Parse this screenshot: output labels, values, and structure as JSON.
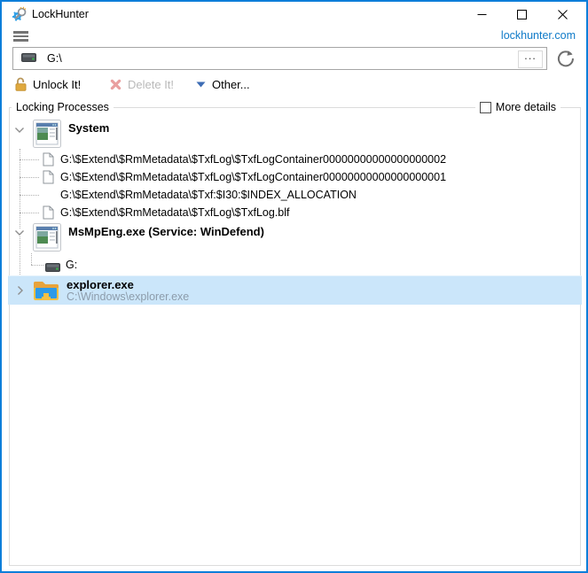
{
  "window": {
    "title": "LockHunter"
  },
  "header": {
    "link": "lockhunter.com"
  },
  "path_bar": {
    "value": "G:\\",
    "browse_label": "..."
  },
  "toolbar": {
    "unlock_label": "Unlock It!",
    "delete_label": "Delete It!",
    "other_label": "Other..."
  },
  "group": {
    "label": "Locking Processes",
    "more_details_label": "More details",
    "more_details_checked": false
  },
  "tree": {
    "groups": [
      {
        "name": "System",
        "children": [
          {
            "text": "G:\\$Extend\\$RmMetadata\\$TxfLog\\$TxfLogContainer00000000000000000002"
          },
          {
            "text": "G:\\$Extend\\$RmMetadata\\$TxfLog\\$TxfLogContainer00000000000000000001"
          },
          {
            "text": "G:\\$Extend\\$RmMetadata\\$Txf:$I30:$INDEX_ALLOCATION"
          },
          {
            "text": "G:\\$Extend\\$RmMetadata\\$TxfLog\\$TxfLog.blf"
          }
        ]
      },
      {
        "name": "MsMpEng.exe (Service: WinDefend)",
        "children": [
          {
            "text": "G:"
          }
        ]
      },
      {
        "name": "explorer.exe",
        "path": "C:\\Windows\\explorer.exe",
        "selected": true
      }
    ]
  }
}
